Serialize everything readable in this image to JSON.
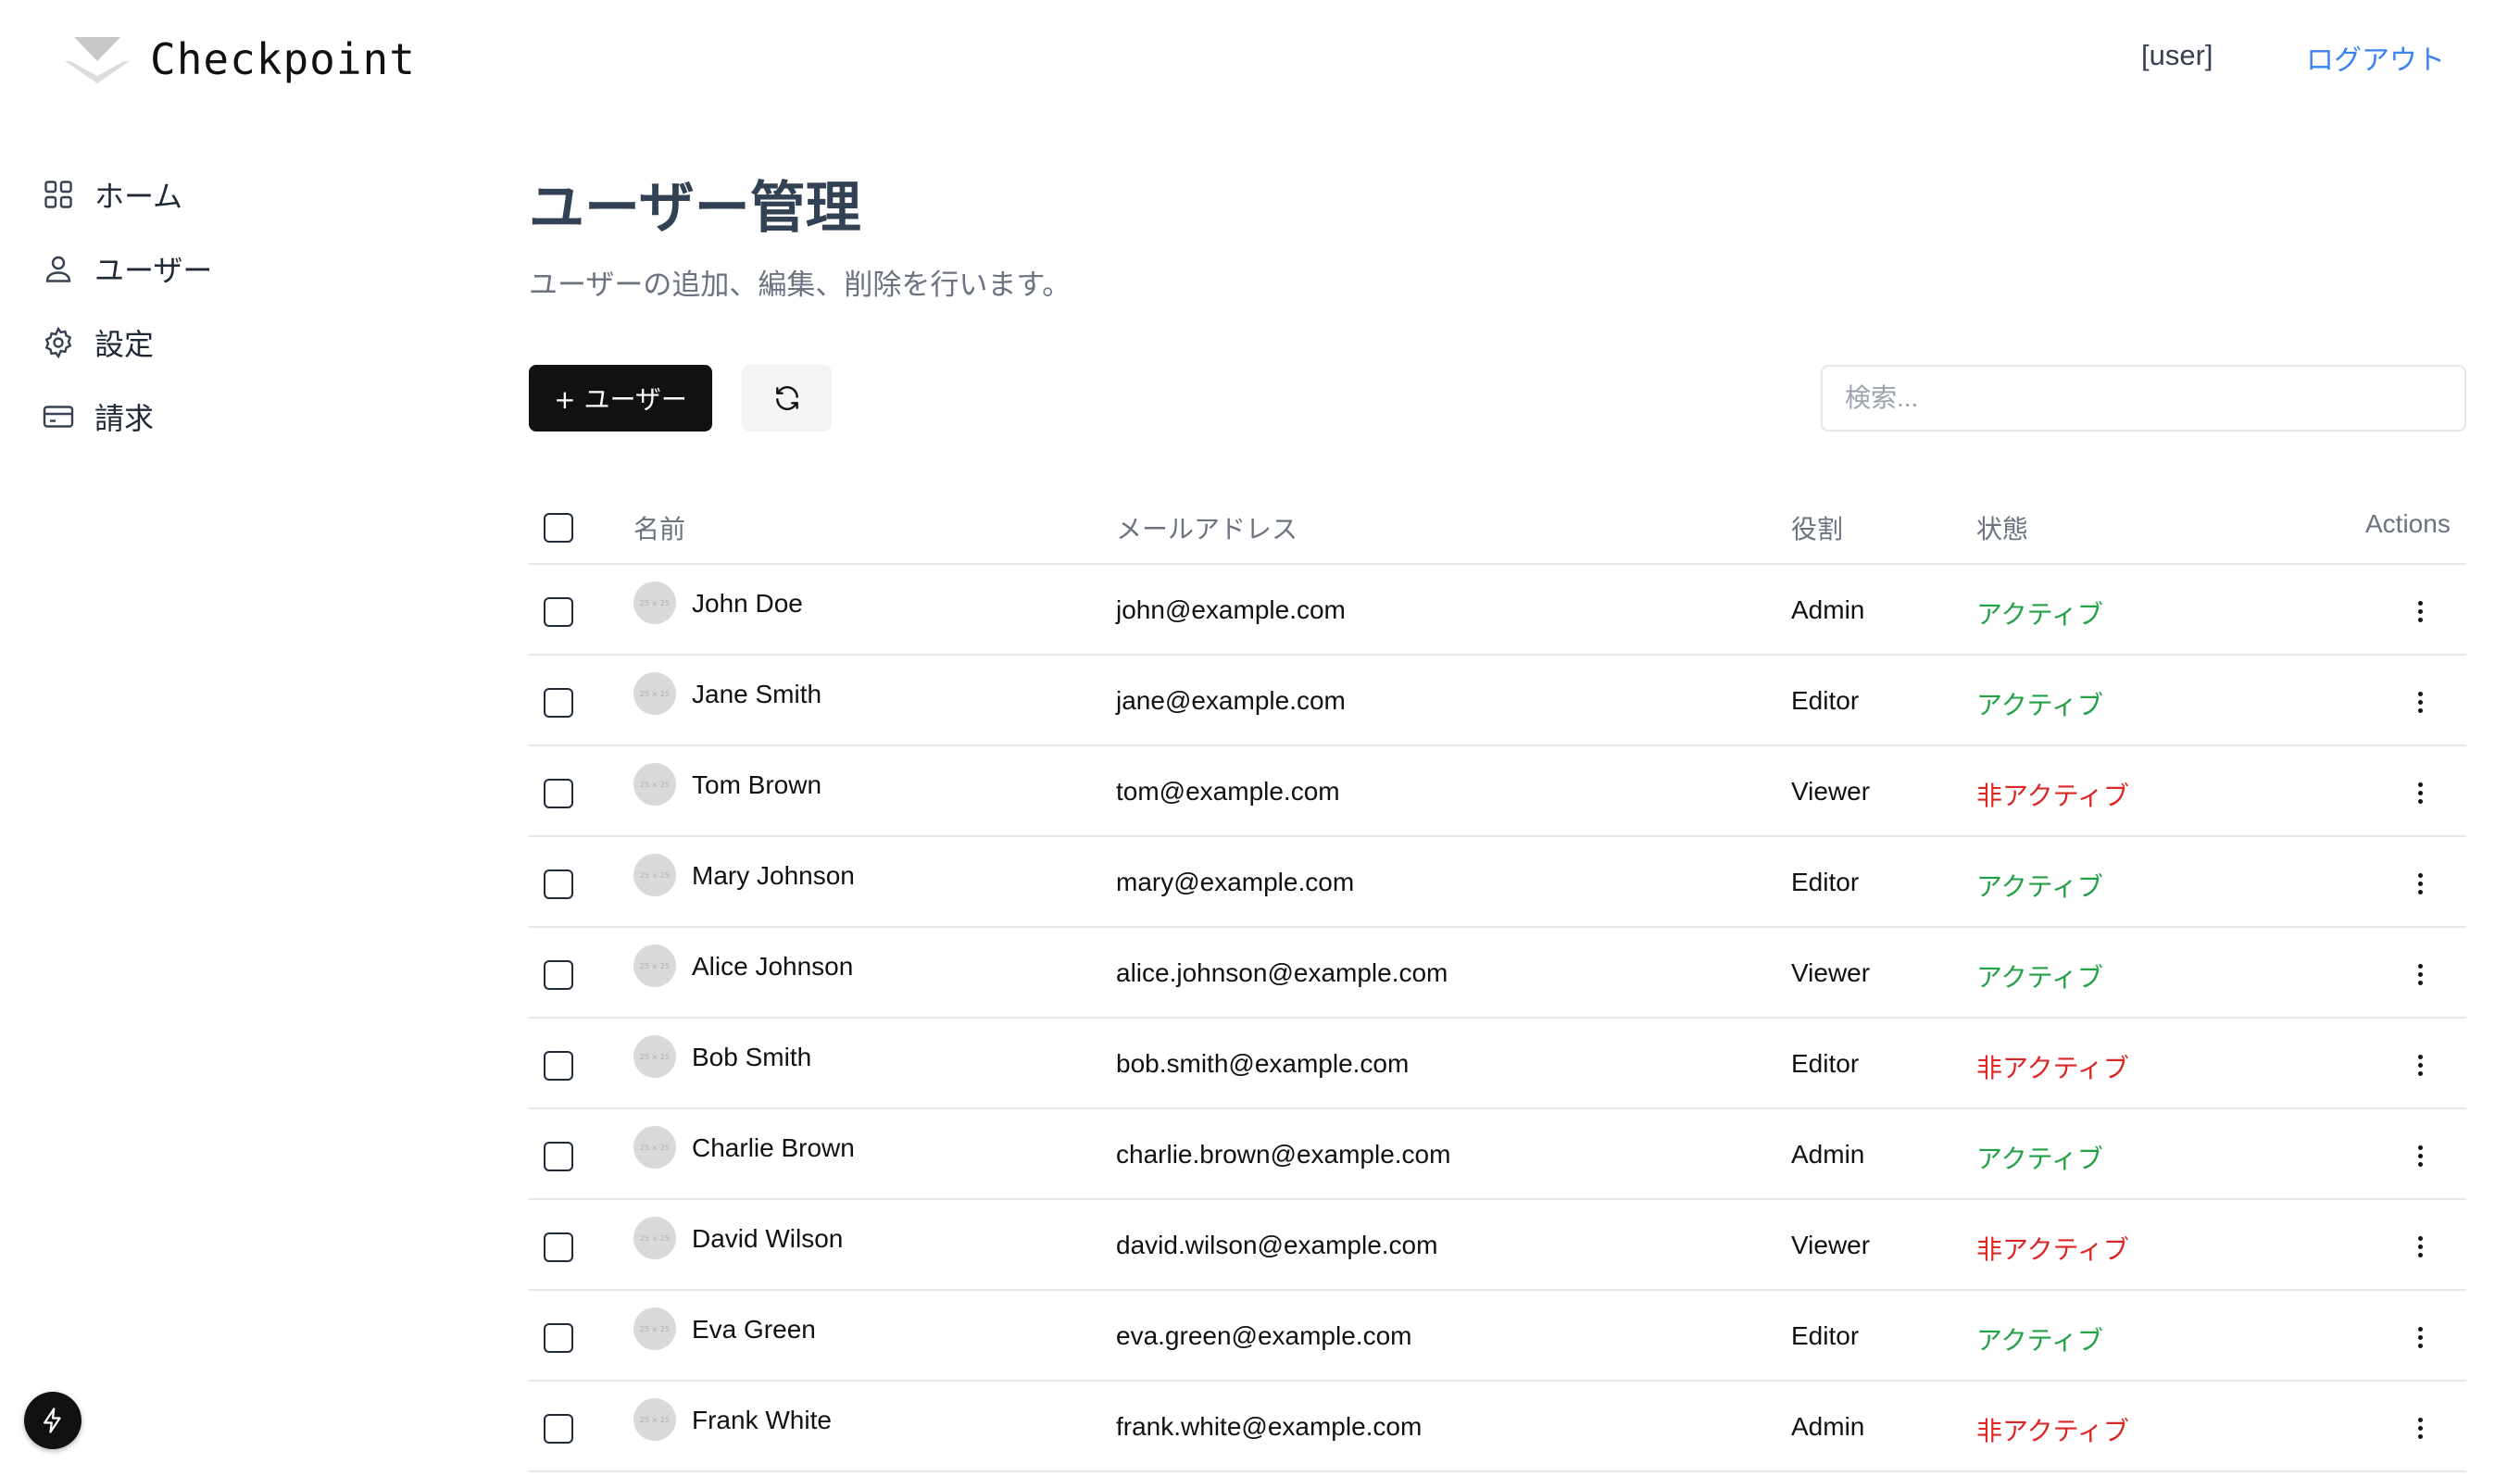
{
  "header": {
    "brand": "Checkpoint",
    "user": "[user]",
    "logout": "ログアウト"
  },
  "sidebar": {
    "items": [
      {
        "label": "ホーム",
        "icon": "grid-icon"
      },
      {
        "label": "ユーザー",
        "icon": "user-icon"
      },
      {
        "label": "設定",
        "icon": "gear-icon"
      },
      {
        "label": "請求",
        "icon": "credit-card-icon"
      }
    ]
  },
  "main": {
    "title": "ユーザー管理",
    "subtitle": "ユーザーの追加、編集、削除を行います。",
    "add_button": "+ ユーザー",
    "search_placeholder": "検索..."
  },
  "table": {
    "columns": {
      "name": "名前",
      "email": "メールアドレス",
      "role": "役割",
      "status": "状態",
      "actions": "Actions"
    },
    "avatar_placeholder": "25 × 25",
    "rows": [
      {
        "name": "John Doe",
        "email": "john@example.com",
        "role": "Admin",
        "status": "アクティブ",
        "active": true
      },
      {
        "name": "Jane Smith",
        "email": "jane@example.com",
        "role": "Editor",
        "status": "アクティブ",
        "active": true
      },
      {
        "name": "Tom Brown",
        "email": "tom@example.com",
        "role": "Viewer",
        "status": "非アクティブ",
        "active": false
      },
      {
        "name": "Mary Johnson",
        "email": "mary@example.com",
        "role": "Editor",
        "status": "アクティブ",
        "active": true
      },
      {
        "name": "Alice Johnson",
        "email": "alice.johnson@example.com",
        "role": "Viewer",
        "status": "アクティブ",
        "active": true
      },
      {
        "name": "Bob Smith",
        "email": "bob.smith@example.com",
        "role": "Editor",
        "status": "非アクティブ",
        "active": false
      },
      {
        "name": "Charlie Brown",
        "email": "charlie.brown@example.com",
        "role": "Admin",
        "status": "アクティブ",
        "active": true
      },
      {
        "name": "David Wilson",
        "email": "david.wilson@example.com",
        "role": "Viewer",
        "status": "非アクティブ",
        "active": false
      },
      {
        "name": "Eva Green",
        "email": "eva.green@example.com",
        "role": "Editor",
        "status": "アクティブ",
        "active": true
      },
      {
        "name": "Frank White",
        "email": "frank.white@example.com",
        "role": "Admin",
        "status": "非アクティブ",
        "active": false
      }
    ]
  },
  "colors": {
    "active": "#22a046",
    "inactive": "#dc2626",
    "link": "#3b82f6",
    "primary_button": "#111111"
  }
}
